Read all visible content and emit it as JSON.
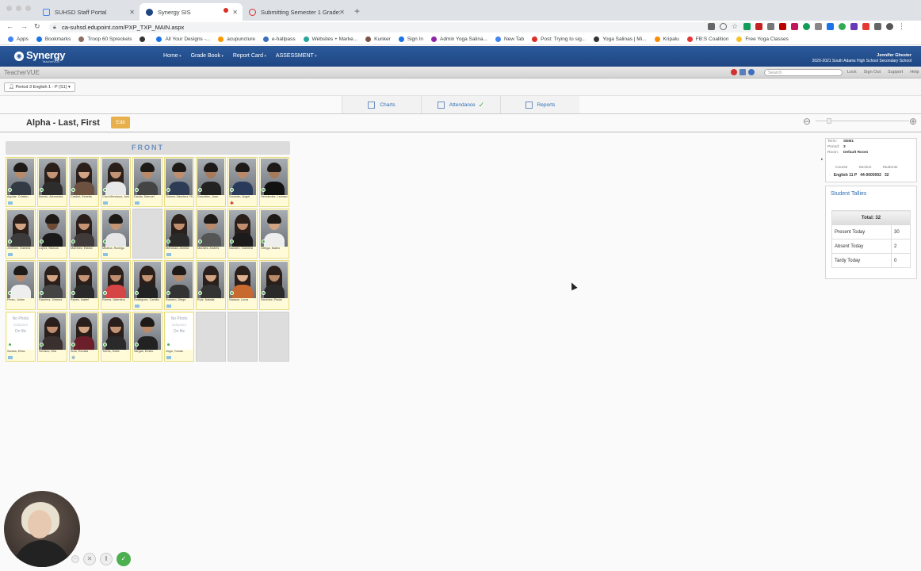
{
  "browser": {
    "tabs": [
      {
        "title": "SUHSD Staff Portal",
        "color": "#4285f4",
        "active": false
      },
      {
        "title": "Synergy SIS",
        "color": "#1e4683",
        "active": true
      },
      {
        "title": "Submitting Semester 1 Grade:",
        "color": "#d93025",
        "active": false
      }
    ],
    "url": "ca-suhsd.edupoint.com/PXP_TXP_MAIN.aspx",
    "bookmarks": [
      "Apps",
      "Bookmarks",
      "Troop 60 Spreckels",
      "",
      "All Your Designs -...",
      "acupuncture",
      "e-hallpass",
      "Websites + Marke...",
      "Kunker",
      "Sign In",
      "Admin Yoga Salina...",
      "New Tab",
      "Post: Trying to sig...",
      "Yoga Salinas | Mi...",
      "Kripalu",
      "FB:S Coalition",
      "Free Yoga Classes"
    ]
  },
  "synergy": {
    "logo": "Synergy",
    "logo_sub": "TeacherVUE",
    "nav": [
      "Home",
      "Grade Book",
      "Report Card",
      "ASSESSMENT"
    ],
    "user_name": "Jennifer Ghester",
    "user_school": "2020-2021 South Adams High School Secondary School",
    "sub_brand": "TeacherVUE",
    "search_placeholder": "Search",
    "links": [
      "Lock",
      "Sign Out",
      "Support",
      "Help"
    ]
  },
  "period_selector": "Period 3 English 1 - P (S1)",
  "view_tabs": [
    "Charts",
    "Attendance",
    "Reports"
  ],
  "chart_title": "Alpha - Last, First",
  "edit_label": "Edit",
  "front_label": "FRONT",
  "seats": [
    {
      "name": "Aguilar, Cristian",
      "skin": "#b88a6a",
      "shirt": "#333a44",
      "long": false,
      "extra": "badge"
    },
    {
      "name": "Barrón, Alexandra",
      "skin": "#c49474",
      "shirt": "#2d2d2d",
      "long": true,
      "extra": ""
    },
    {
      "name": "Cardiel, Estrella",
      "skin": "#d3a483",
      "shirt": "#6c5040",
      "long": true,
      "extra": ""
    },
    {
      "name": "Cruz-Mendoza, Jordan",
      "skin": "#c49474",
      "shirt": "#e8e8e8",
      "long": true,
      "extra": "badge"
    },
    {
      "name": "Dávila, Samuel",
      "skin": "#b88a6a",
      "shirt": "#444",
      "long": false,
      "extra": "badge"
    },
    {
      "name": "Gómez-Sánchez, Ricardo",
      "skin": "#c08e6e",
      "shirt": "#2e3b54",
      "long": false,
      "extra": ""
    },
    {
      "name": "González, Juan",
      "skin": "#a77a5a",
      "shirt": "#222",
      "long": false,
      "extra": ""
    },
    {
      "name": "Guzmán, Ángel",
      "skin": "#b88a6a",
      "shirt": "#2a3a5a",
      "long": false,
      "extra": "flag"
    },
    {
      "name": "Hernández, Leonardo",
      "skin": "#a77a5a",
      "shirt": "#111",
      "long": false,
      "extra": ""
    },
    {
      "name": "Jiménez, Daniela",
      "skin": "#d3a483",
      "shirt": "#3b3b3b",
      "long": true,
      "extra": "badge"
    },
    {
      "name": "López, Marcus",
      "skin": "#6e4a34",
      "shirt": "#1a1a1a",
      "long": false,
      "extra": ""
    },
    {
      "name": "Martínez, Estela",
      "skin": "#c49474",
      "shirt": "#403a3a",
      "long": true,
      "extra": ""
    },
    {
      "name": "Medina, Rodrigo",
      "skin": "#c49474",
      "shirt": "#e6e6e6",
      "long": false,
      "extra": "badge"
    },
    {
      "name": "",
      "skin": "",
      "shirt": "",
      "long": false,
      "extra": "empty"
    },
    {
      "name": "Mendoza, Amelia",
      "skin": "#c08e6e",
      "shirt": "#2a2a2a",
      "long": true,
      "extra": "badge"
    },
    {
      "name": "Morales, Andrés",
      "skin": "#b88a6a",
      "shirt": "#555",
      "long": false,
      "extra": ""
    },
    {
      "name": "Navarro, Gabriela",
      "skin": "#c08e6e",
      "shirt": "#1b1b1b",
      "long": true,
      "extra": ""
    },
    {
      "name": "Ortega, Mateo",
      "skin": "#d3a483",
      "shirt": "#eee",
      "long": false,
      "extra": ""
    },
    {
      "name": "Pérez, Julián",
      "skin": "#b88a6a",
      "shirt": "#eee",
      "long": false,
      "extra": ""
    },
    {
      "name": "Ramírez, Ximena",
      "skin": "#d3a483",
      "shirt": "#444",
      "long": true,
      "extra": ""
    },
    {
      "name": "Reyes, Isabel",
      "skin": "#c49474",
      "shirt": "#2a2a2a",
      "long": true,
      "extra": ""
    },
    {
      "name": "Rivera, Valentina",
      "skin": "#c08e6e",
      "shirt": "#d64545",
      "long": true,
      "extra": ""
    },
    {
      "name": "Rodríguez, Camila",
      "skin": "#c49474",
      "shirt": "#222",
      "long": true,
      "extra": "badge"
    },
    {
      "name": "Romero, Diego",
      "skin": "#b88a6a",
      "shirt": "#333",
      "long": false,
      "extra": "badge"
    },
    {
      "name": "Ruiz, Natalia",
      "skin": "#d3a483",
      "shirt": "#333",
      "long": true,
      "extra": ""
    },
    {
      "name": "Salazar, Lucía",
      "skin": "#e0b090",
      "shirt": "#c86a30",
      "long": true,
      "extra": ""
    },
    {
      "name": "Sánchez, Paola",
      "skin": "#b88a6a",
      "shirt": "#2a2a2a",
      "long": true,
      "extra": ""
    },
    {
      "name": "Santos, Elías",
      "skin": "",
      "shirt": "",
      "long": false,
      "extra": "nophoto"
    },
    {
      "name": "Serrano, Mía",
      "skin": "#c08e6e",
      "shirt": "#3a3030",
      "long": true,
      "extra": ""
    },
    {
      "name": "Soto, Renata",
      "skin": "#d3a483",
      "shirt": "#6a1f2a",
      "long": true,
      "extra": "flag2"
    },
    {
      "name": "Torres, Sofía",
      "skin": "#c49474",
      "shirt": "#2a2a2a",
      "long": true,
      "extra": ""
    },
    {
      "name": "Vargas, Emilio",
      "skin": "#b88a6a",
      "shirt": "#222",
      "long": false,
      "extra": ""
    },
    {
      "name": "Vega, Tomás",
      "skin": "",
      "shirt": "",
      "long": false,
      "extra": "nophoto"
    },
    {
      "name": "",
      "skin": "",
      "shirt": "",
      "long": false,
      "extra": "empty"
    },
    {
      "name": "",
      "skin": "",
      "shirt": "",
      "long": false,
      "extra": "empty"
    },
    {
      "name": "",
      "skin": "",
      "shirt": "",
      "long": false,
      "extra": "empty"
    }
  ],
  "no_photo": {
    "line1": "No Photo",
    "line2": "Edupoint",
    "line3": "On file"
  },
  "info": {
    "term_label": "Term:",
    "term": "SEM1",
    "period_label": "Period:",
    "period": "3",
    "room_label": "Room:",
    "room": "Default Room",
    "course_hdr": "Course",
    "section_hdr": "Section",
    "students_hdr": "Students",
    "course": "English 11 P",
    "section": "44-0000002",
    "students": "32"
  },
  "tallies": {
    "title": "Student Tallies",
    "total": "Total: 32",
    "rows": [
      {
        "label": "Present Today",
        "value": "30"
      },
      {
        "label": "Absent Today",
        "value": "2"
      },
      {
        "label": "Tardy Today",
        "value": "0"
      }
    ]
  },
  "colors": {
    "header": "#1e4683",
    "accent": "#2d6db5",
    "edit": "#e8b04d",
    "seat": "#fffbd8",
    "present": "#4caf50"
  }
}
